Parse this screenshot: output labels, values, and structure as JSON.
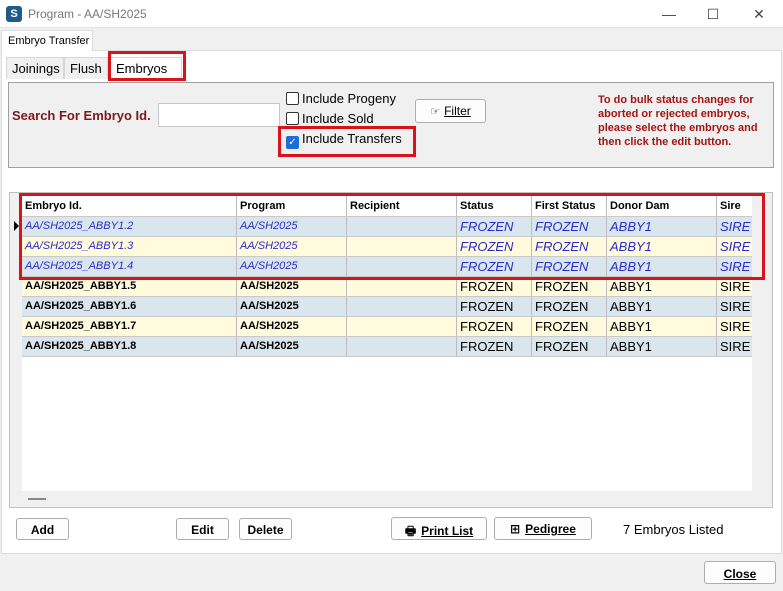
{
  "window": {
    "app_icon": "S",
    "title": "Program - AA/SH2025",
    "minimize": "—",
    "maximize": "☐",
    "close": "✕"
  },
  "outer_tab": "Embryo Transfer",
  "tabs": [
    "Joinings",
    "Flush",
    "Embryos"
  ],
  "filter": {
    "search_label": "Search For Embryo Id.",
    "search_value": "",
    "include_progeny": "Include Progeny",
    "include_sold": "Include Sold",
    "include_transfers": "Include Transfers",
    "include_progeny_checked": false,
    "include_sold_checked": false,
    "include_transfers_checked": true,
    "filter_button": "Filter",
    "help_text": "To do bulk status changes for aborted or rejected embryos, please select the embryos and then click the edit button."
  },
  "grid": {
    "columns": [
      "Embryo Id.",
      "Program",
      "Recipient",
      "Status",
      "First Status",
      "Donor Dam",
      "Sire"
    ],
    "rows": [
      {
        "id": "AA/SH2025_ABBY1.2",
        "program": "AA/SH2025",
        "recipient": "",
        "status": "FROZEN",
        "first_status": "FROZEN",
        "donor": "ABBY1",
        "sire": "SIRE"
      },
      {
        "id": "AA/SH2025_ABBY1.3",
        "program": "AA/SH2025",
        "recipient": "",
        "status": "FROZEN",
        "first_status": "FROZEN",
        "donor": "ABBY1",
        "sire": "SIRE"
      },
      {
        "id": "AA/SH2025_ABBY1.4",
        "program": "AA/SH2025",
        "recipient": "",
        "status": "FROZEN",
        "first_status": "FROZEN",
        "donor": "ABBY1",
        "sire": "SIRE"
      },
      {
        "id": "AA/SH2025_ABBY1.5",
        "program": "AA/SH2025",
        "recipient": "",
        "status": "FROZEN",
        "first_status": "FROZEN",
        "donor": "ABBY1",
        "sire": "SIRE"
      },
      {
        "id": "AA/SH2025_ABBY1.6",
        "program": "AA/SH2025",
        "recipient": "",
        "status": "FROZEN",
        "first_status": "FROZEN",
        "donor": "ABBY1",
        "sire": "SIRE"
      },
      {
        "id": "AA/SH2025_ABBY1.7",
        "program": "AA/SH2025",
        "recipient": "",
        "status": "FROZEN",
        "first_status": "FROZEN",
        "donor": "ABBY1",
        "sire": "SIRE"
      },
      {
        "id": "AA/SH2025_ABBY1.8",
        "program": "AA/SH2025",
        "recipient": "",
        "status": "FROZEN",
        "first_status": "FROZEN",
        "donor": "ABBY1",
        "sire": "SIRE"
      }
    ]
  },
  "buttons": {
    "add": "Add",
    "edit": "Edit",
    "delete": "Delete",
    "print_list": "Print List",
    "pedigree": "Pedigree",
    "close": "Close"
  },
  "status": {
    "count": "7 Embryos Listed"
  },
  "colors": {
    "highlight_box": "#d9121b",
    "row_blue": "#d9e6ee",
    "row_yellow": "#fffbdc",
    "selected_text": "#2b2bc8",
    "label_red": "#7b1a1a",
    "help_red": "#a41414"
  }
}
